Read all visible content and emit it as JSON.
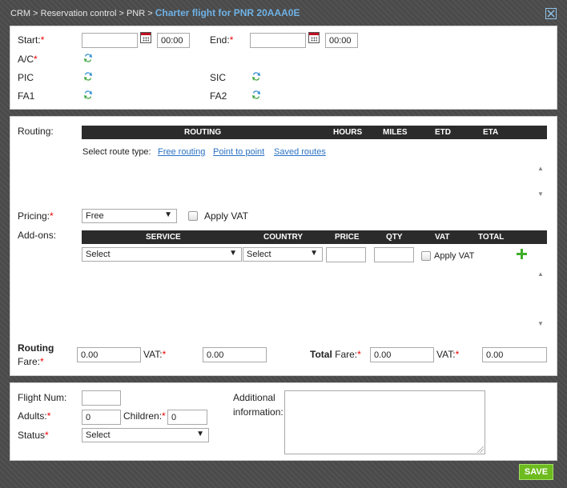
{
  "breadcrumb": {
    "crm": "CRM",
    "sep1": ">",
    "reservation_control": "Reservation control",
    "sep2": ">",
    "pnr": "PNR",
    "sep3": ">",
    "title": "Charter flight for PNR 20AAA0E"
  },
  "general": {
    "start_label": "Start:",
    "start_date": "",
    "start_time": "00:00",
    "end_label": "End:",
    "end_date": "",
    "end_time": "00:00",
    "ac_label": "A/C",
    "pic_label": "PIC",
    "sic_label": "SIC",
    "fa1_label": "FA1",
    "fa2_label": "FA2",
    "required_mark": "*"
  },
  "routing": {
    "label": "Routing:",
    "columns": [
      "ROUTING",
      "HOURS",
      "MILES",
      "ETD",
      "ETA"
    ],
    "route_type_label": "Select route type:",
    "route_types": [
      "Free routing",
      "Point to point",
      "Saved routes"
    ]
  },
  "pricing": {
    "label": "Pricing:",
    "value": "Free",
    "apply_vat_label": "Apply VAT"
  },
  "addons": {
    "label": "Add-ons:",
    "columns": [
      "SERVICE",
      "COUNTRY",
      "PRICE",
      "QTY",
      "VAT",
      "TOTAL"
    ],
    "service_value": "Select",
    "country_value": "Select",
    "price_value": "",
    "qty_value": "",
    "apply_vat_label": "Apply VAT"
  },
  "fares": {
    "routing_fare_label_1": "Routing",
    "routing_fare_label_2": "Fare:",
    "routing_fare_value": "0.00",
    "vat_label": "VAT:",
    "routing_vat_value": "0.00",
    "total_label_bold": "Total",
    "total_label_rest": " Fare:",
    "total_fare_value": "0.00",
    "total_vat_value": "0.00"
  },
  "flight": {
    "flight_num_label": "Flight Num:",
    "flight_num_value": "",
    "adults_label": "Adults:",
    "adults_value": "0",
    "children_label": "Children:",
    "children_value": "0",
    "status_label": "Status",
    "status_value": "Select",
    "additional_label_1": "Additional",
    "additional_label_2": "information:",
    "additional_value": ""
  },
  "actions": {
    "save_label": "SAVE"
  },
  "colors": {
    "accent_title": "#6fb2e6",
    "header_bar": "#2b2b2b",
    "required": "#ee0000",
    "save_button": "#6dbb1e",
    "link": "#2a72c4"
  }
}
